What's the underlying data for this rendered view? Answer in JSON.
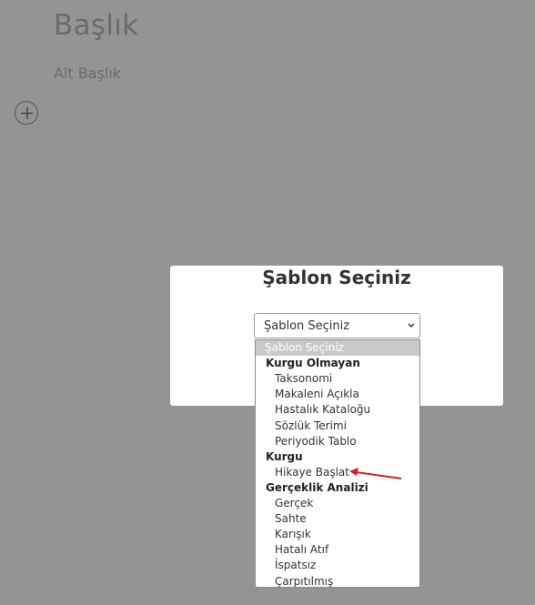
{
  "document": {
    "title": "Başlık",
    "subtitle": "Alt Başlık"
  },
  "modal": {
    "title": "Şablon Seçiniz"
  },
  "select": {
    "value": "Şablon Seçiniz",
    "options": [
      {
        "label": "Şablon Seçiniz",
        "kind": "selected"
      },
      {
        "label": "Kurgu Olmayan",
        "kind": "group"
      },
      {
        "label": "Taksonomi",
        "kind": "child"
      },
      {
        "label": "Makaleni Açıkla",
        "kind": "child"
      },
      {
        "label": "Hastalık Kataloğu",
        "kind": "child"
      },
      {
        "label": "Sözlük Terimi",
        "kind": "child"
      },
      {
        "label": "Periyodik Tablo",
        "kind": "child"
      },
      {
        "label": "Kurgu",
        "kind": "group"
      },
      {
        "label": "Hikaye Başlat",
        "kind": "child"
      },
      {
        "label": "Gerçeklik Analizi",
        "kind": "group"
      },
      {
        "label": "Gerçek",
        "kind": "child"
      },
      {
        "label": "Sahte",
        "kind": "child"
      },
      {
        "label": "Karışık",
        "kind": "child"
      },
      {
        "label": "Hatalı Atıf",
        "kind": "child"
      },
      {
        "label": "İspatsız",
        "kind": "child"
      },
      {
        "label": "Çarpıtılmış",
        "kind": "child"
      }
    ]
  },
  "colors": {
    "overlay": "#949494",
    "arrow": "#d42020"
  },
  "icons": {
    "add": "plus-icon",
    "select_caret": "chevron-down-icon"
  }
}
